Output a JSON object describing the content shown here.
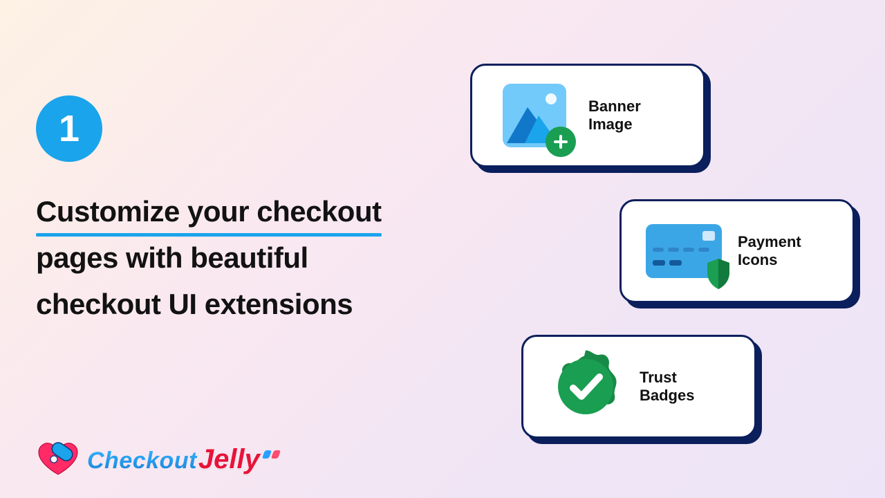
{
  "step": {
    "number": "1"
  },
  "headline": {
    "line1": "Customize your checkout",
    "line2": "pages with beautiful",
    "line3": "checkout UI extensions"
  },
  "cards": {
    "banner": {
      "label": "Banner Image"
    },
    "payment": {
      "label": "Payment Icons"
    },
    "trust": {
      "label": "Trust Badges"
    }
  },
  "logo": {
    "word1": "Checkout",
    "word2": "Jelly"
  },
  "colors": {
    "accent": "#1aa4eb",
    "cardBorder": "#0b1f5c",
    "green": "#1a9e52",
    "red": "#e7133a"
  }
}
